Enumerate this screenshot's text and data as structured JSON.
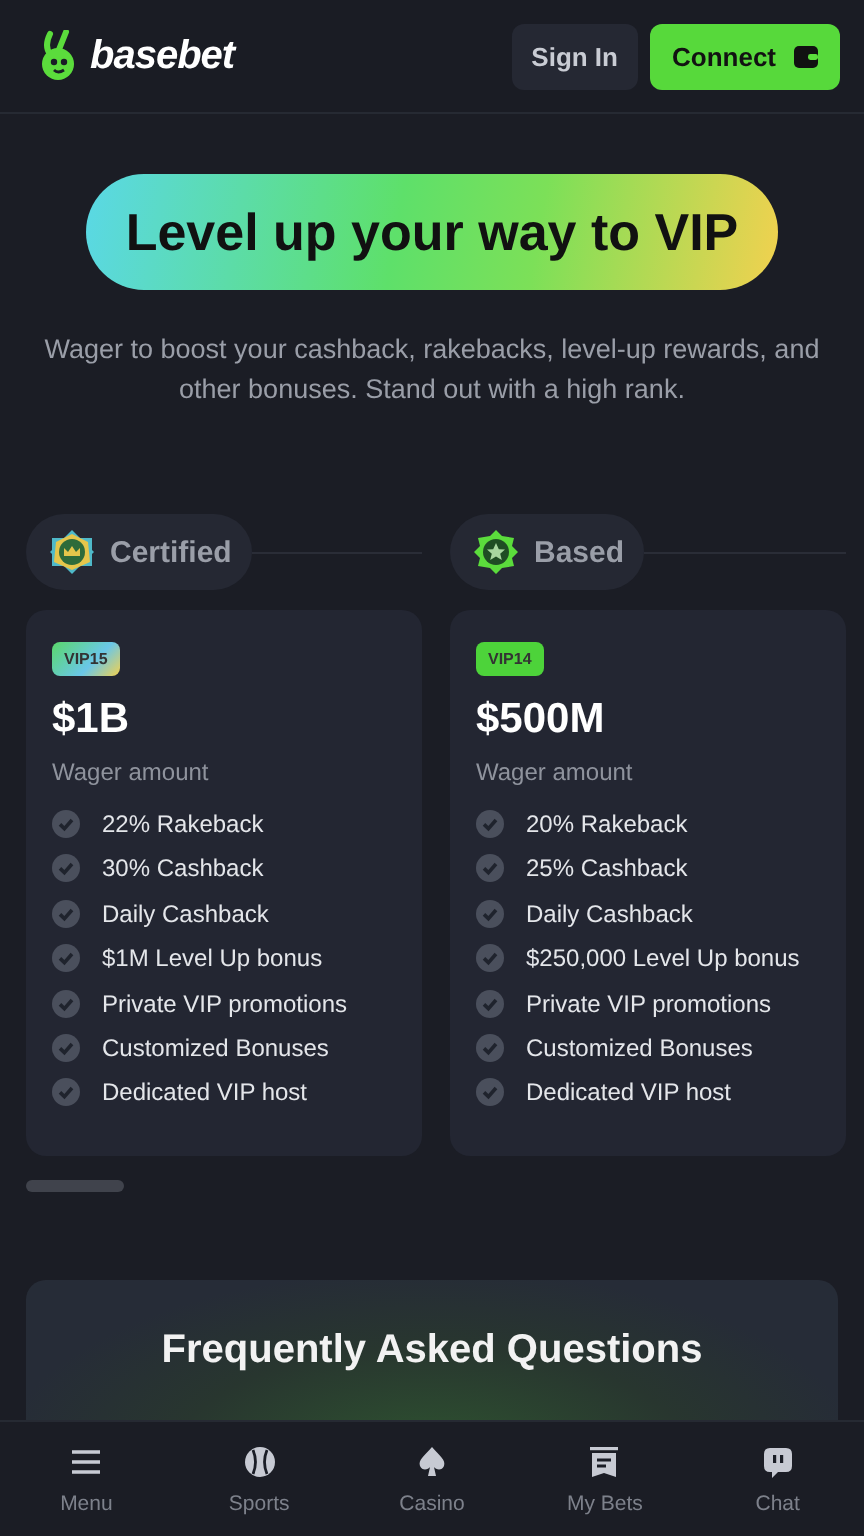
{
  "header": {
    "logo": "basebet",
    "buttons": [
      {
        "label": "Sign In",
        "kind": "secondary"
      },
      {
        "label": "Connect",
        "kind": "primary"
      }
    ]
  },
  "hero": {
    "title": "Level up your way to VIP",
    "subtitle": "Wager to boost your cashback, rakebacks, level-up rewards, and other bonuses. Stand out with a high rank."
  },
  "tiers": [
    {
      "name": "Certified",
      "badge": {
        "label": "VIP15",
        "kind": "rainbow"
      },
      "amount": "$1B",
      "amount_label": "Wager amount",
      "perks": [
        "22% Rakeback",
        "30% Cashback",
        "Daily Cashback",
        "$1M Level Up bonus",
        "Private VIP promotions",
        "Customized Bonuses",
        "Dedicated VIP host"
      ]
    },
    {
      "name": "Based",
      "badge": {
        "label": "VIP14",
        "kind": "green"
      },
      "amount": "$500M",
      "amount_label": "Wager amount",
      "perks": [
        "20% Rakeback",
        "25% Cashback",
        "Daily Cashback",
        "$250,000 Level Up bonus",
        "Private VIP promotions",
        "Customized Bonuses",
        "Dedicated VIP host"
      ]
    }
  ],
  "faq": {
    "title": "Frequently Asked Questions"
  },
  "nav": [
    {
      "label": "Menu"
    },
    {
      "label": "Sports"
    },
    {
      "label": "Casino"
    },
    {
      "label": "My Bets"
    },
    {
      "label": "Chat"
    }
  ]
}
